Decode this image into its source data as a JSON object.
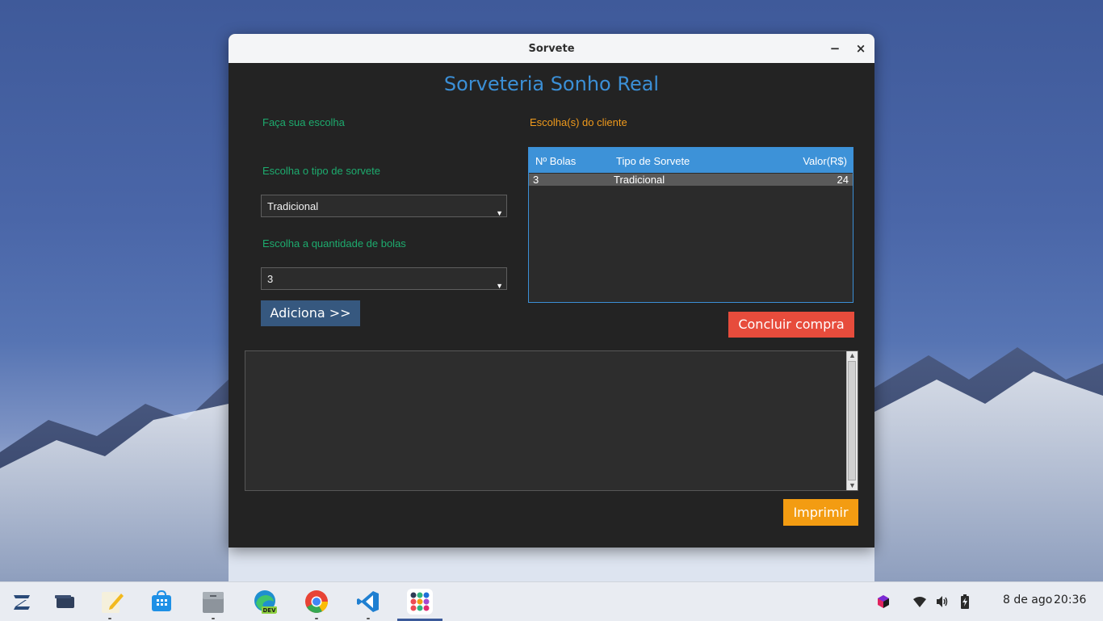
{
  "window": {
    "title": "Sorvete",
    "minimize_glyph": "−",
    "close_glyph": "×"
  },
  "app": {
    "heading": "Sorveteria Sonho Real",
    "left_label": "Faça sua escolha",
    "right_label": "Escolha(s) do cliente",
    "type_label": "Escolha o tipo de sorvete",
    "type_selected": "Tradicional",
    "qty_label": "Escolha a quantidade de bolas",
    "qty_selected": "3",
    "add_button": "Adiciona >>",
    "finish_button": "Concluir compra",
    "print_button": "Imprimir",
    "output_text": ""
  },
  "table": {
    "columns": [
      "Nº Bolas",
      "Tipo de Sorvete",
      "Valor(R$)"
    ],
    "rows": [
      {
        "bolas": "3",
        "tipo": "Tradicional",
        "valor": "24"
      }
    ]
  },
  "taskbar": {
    "apps": [
      "zorin-menu-icon",
      "files-window-icon",
      "text-editor-icon",
      "software-store-icon",
      "file-cabinet-icon",
      "edge-dev-icon",
      "chrome-icon",
      "vscode-icon",
      "app-grid-icon"
    ],
    "edge_badge": "DEV",
    "date": "8 de ago",
    "time": "20:36"
  },
  "colors": {
    "heading": "#3b8fd6",
    "green_label": "#1dab6e",
    "orange_label": "#f09a1c",
    "add_button": "#36587f",
    "finish_button": "#e74c3c",
    "print_button": "#f39c12",
    "table_header": "#3d92d8"
  }
}
